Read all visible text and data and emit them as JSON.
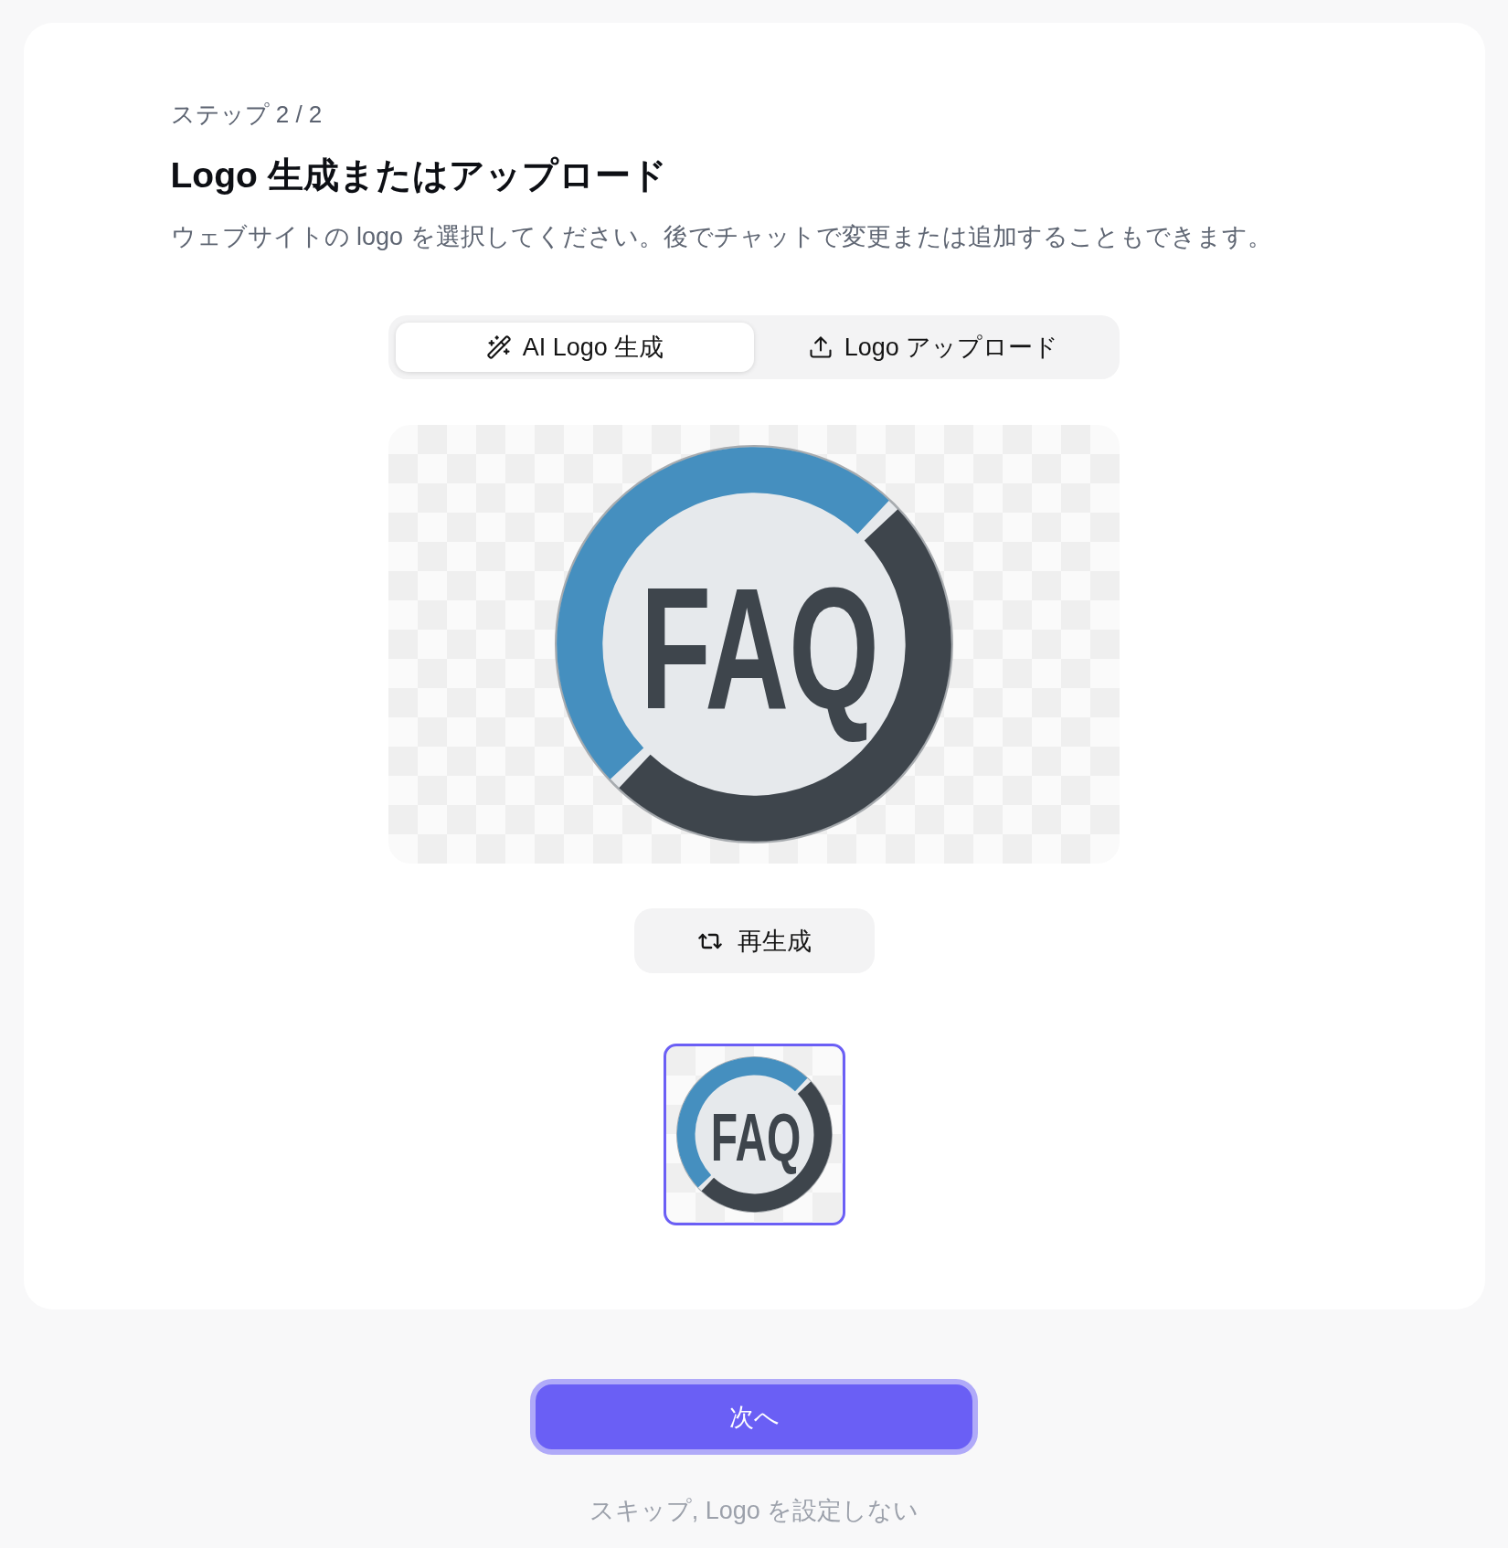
{
  "step": {
    "label": "ステップ 2 / 2"
  },
  "title": "Logo 生成またはアップロード",
  "description": "ウェブサイトの logo を選択してください。後でチャットで変更または追加することもできます。",
  "tabs": [
    {
      "label": "AI Logo 生成",
      "kind": "generate",
      "selected": true
    },
    {
      "label": "Logo アップロード",
      "kind": "upload",
      "selected": false
    }
  ],
  "preview": {
    "logo_text": "FAQ"
  },
  "regenerate_button": {
    "label": "再生成"
  },
  "thumbnails": [
    {
      "logo_text": "FAQ",
      "selected": true
    }
  ],
  "next_button": {
    "label": "次へ"
  },
  "skip_link": {
    "label": "スキップ, Logo を設定しない"
  }
}
